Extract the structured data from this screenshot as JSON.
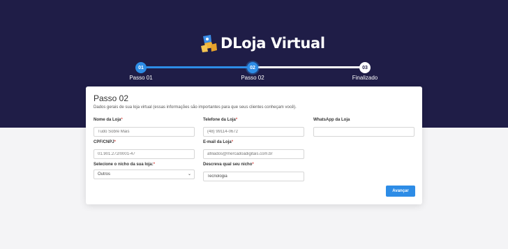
{
  "brand": {
    "name": "DLoja Virtual"
  },
  "steps": [
    {
      "number": "01",
      "label": "Passo 01",
      "state": "done"
    },
    {
      "number": "02",
      "label": "Passo 02",
      "state": "active"
    },
    {
      "number": "03",
      "label": "Finalizado",
      "state": "pending"
    }
  ],
  "colors": {
    "hero_bg": "#1f1d47",
    "accent": "#2d8ce6",
    "required": "#d9534f"
  },
  "form": {
    "title": "Passo 02",
    "subtitle": "Dados gerais de sua loja virtual (essas informações são importantes para que seus clientes conheçam você).",
    "store_name": {
      "label": "Nome da Loja",
      "required": "*",
      "placeholder": "Tudo Sobre Mais"
    },
    "phone": {
      "label": "Telefone da Loja",
      "required": "*",
      "placeholder": "(48) 99114-0672"
    },
    "whatsapp": {
      "label": "WhatsApp da Loja",
      "placeholder": ""
    },
    "document": {
      "label": "CPF/CNPJ",
      "required": "*",
      "placeholder": "01.901.272/0001-47"
    },
    "email": {
      "label": "E-mail da Loja",
      "required": "*",
      "placeholder": "afiliados@mercadoadigitais.com.br"
    },
    "niche": {
      "label": "Selecione o nicho da sua loja:",
      "required": "*",
      "selected": "Outros"
    },
    "niche_description": {
      "label": "Descreva qual seu nicho",
      "required": "*",
      "value": "Tecnologia"
    },
    "submit_label": "Avançar"
  }
}
